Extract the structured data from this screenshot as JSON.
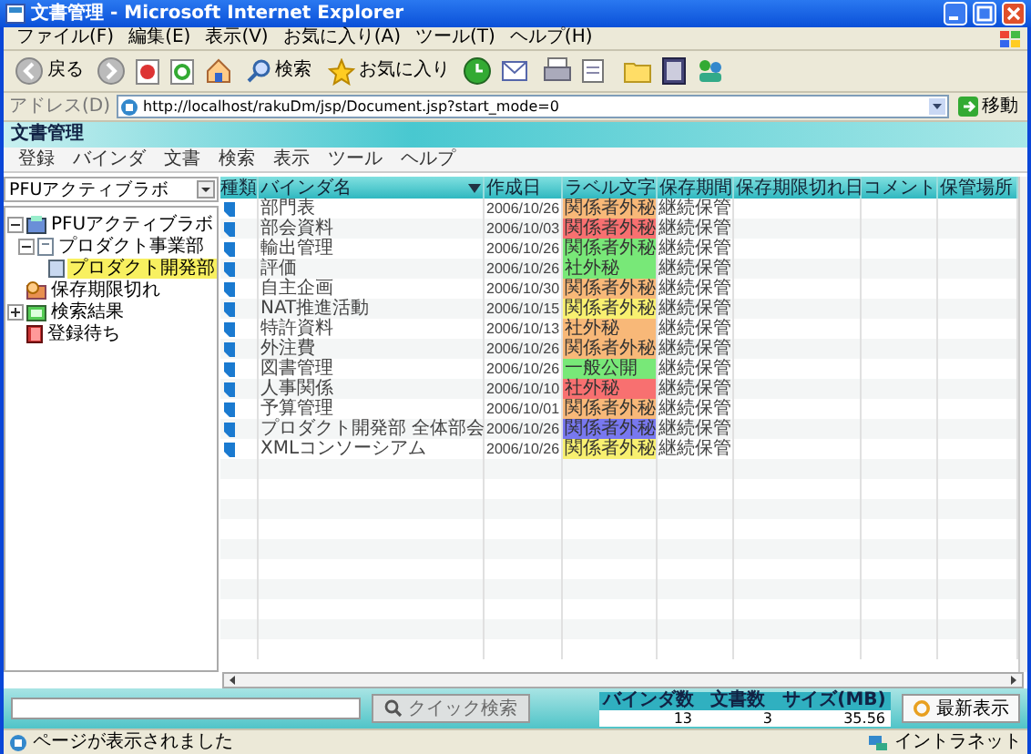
{
  "window": {
    "title": "文書管理 - Microsoft Internet Explorer"
  },
  "menu_bar": [
    "ファイル(F)",
    "編集(E)",
    "表示(V)",
    "お気に入り(A)",
    "ツール(T)",
    "ヘルプ(H)"
  ],
  "toolbar": {
    "back": "戻る",
    "search": "検索",
    "favorites": "お気に入り"
  },
  "address_bar": {
    "label": "アドレス(D)",
    "url": "http://localhost/rakuDm/jsp/Document.jsp?start_mode=0",
    "go": "移動"
  },
  "app": {
    "title": "文書管理",
    "menu": [
      "登録",
      "バインダ",
      "文書",
      "検索",
      "表示",
      "ツール",
      "ヘルプ"
    ],
    "cabinet_select": "PFUアクティブラボ",
    "tree": [
      {
        "label": "PFUアクティブラボ",
        "kind": "cabinet",
        "expanded": true,
        "selected": false,
        "children": [
          {
            "label": "プロダクト事業部",
            "kind": "folder",
            "expanded": true,
            "selected": false,
            "children": [
              {
                "label": "プロダクト開発部",
                "kind": "binder",
                "selected": true
              }
            ]
          }
        ]
      },
      {
        "label": "保存期限切れ",
        "kind": "expired",
        "selected": false
      },
      {
        "label": "検索結果",
        "kind": "search",
        "expanded": false,
        "selected": false
      },
      {
        "label": "登録待ち",
        "kind": "pending",
        "selected": false
      }
    ],
    "table": {
      "columns": [
        {
          "label": "種類",
          "sorted": false
        },
        {
          "label": "バインダ名",
          "sorted": true
        },
        {
          "label": "作成日",
          "sorted": false
        },
        {
          "label": "ラベル文字",
          "sorted": false
        },
        {
          "label": "保存期間",
          "sorted": false
        },
        {
          "label": "保存期限切れ日",
          "sorted": false
        },
        {
          "label": "コメント",
          "sorted": false
        },
        {
          "label": "保管場所",
          "sorted": false
        }
      ],
      "rows": [
        {
          "binder": "部門表",
          "created": "2006/10/26",
          "label": "関係者外秘",
          "color": "#f8b878",
          "retention": "継続保管"
        },
        {
          "binder": "部会資料",
          "created": "2006/10/03",
          "label": "関係者外秘",
          "color": "#f87070",
          "retention": "継続保管"
        },
        {
          "binder": "輸出管理",
          "created": "2006/10/26",
          "label": "関係者外秘",
          "color": "#78e878",
          "retention": "継続保管"
        },
        {
          "binder": "評価",
          "created": "2006/10/26",
          "label": "社外秘",
          "color": "#78e878",
          "retention": "継続保管"
        },
        {
          "binder": "自主企画",
          "created": "2006/10/30",
          "label": "関係者外秘",
          "color": "#f8b878",
          "retention": "継続保管"
        },
        {
          "binder": "NAT推進活動",
          "created": "2006/10/15",
          "label": "関係者外秘",
          "color": "#f8f070",
          "retention": "継続保管"
        },
        {
          "binder": "特許資料",
          "created": "2006/10/13",
          "label": "社外秘",
          "color": "#f8b878",
          "retention": "継続保管"
        },
        {
          "binder": "外注費",
          "created": "2006/10/26",
          "label": "関係者外秘",
          "color": "#f8b878",
          "retention": "継続保管"
        },
        {
          "binder": "図書管理",
          "created": "2006/10/26",
          "label": "一般公開",
          "color": "#78e878",
          "retention": "継続保管"
        },
        {
          "binder": "人事関係",
          "created": "2006/10/10",
          "label": "社外秘",
          "color": "#f87070",
          "retention": "継続保管"
        },
        {
          "binder": "予算管理",
          "created": "2006/10/01",
          "label": "関係者外秘",
          "color": "#f8b878",
          "retention": "継続保管"
        },
        {
          "binder": "プロダクト開発部 全体部会",
          "created": "2006/10/26",
          "label": "関係者外秘",
          "color": "#7878f0",
          "retention": "継続保管"
        },
        {
          "binder": "XMLコンソーシアム",
          "created": "2006/10/26",
          "label": "関係者外秘",
          "color": "#f8f070",
          "retention": "継続保管"
        }
      ]
    },
    "footer": {
      "quick_search": {
        "label": "クイック検索",
        "disabled": true
      },
      "stats": [
        {
          "label": "バインダ数",
          "value": "13"
        },
        {
          "label": "文書数",
          "value": "3"
        },
        {
          "label": "サイズ(MB)",
          "value": "35.56"
        }
      ],
      "refresh": "最新表示"
    }
  },
  "status_bar": {
    "message": "ページが表示されました",
    "zone": "イントラネット"
  }
}
